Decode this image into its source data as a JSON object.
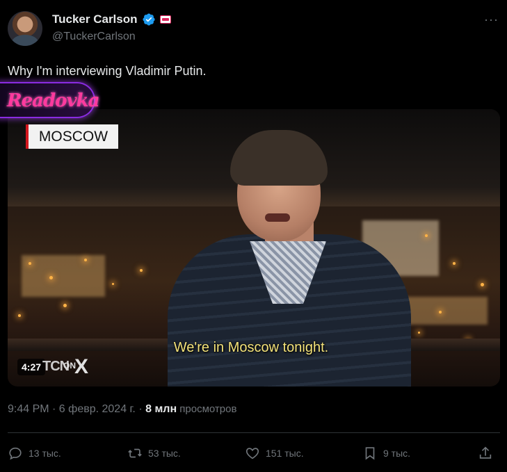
{
  "author": {
    "name": "Tucker Carlson",
    "handle": "@TuckerCarlson",
    "verified_icon": "verified-badge-icon",
    "org_icon": "tcn-org-badge-icon",
    "more_label": "···"
  },
  "tweet": {
    "text": "Why I'm interviewing Vladimir Putin."
  },
  "overlay": {
    "watermark": "Readovka"
  },
  "video": {
    "location_label": "MOSCOW",
    "caption": "We're in Moscow tonight.",
    "duration": "4:27",
    "logo_tcn": "TCN",
    "logo_on": "ON",
    "logo_x": "X"
  },
  "meta": {
    "time": "9:44 PM · 6 февр. 2024 г. · ",
    "views_count": "8 млн",
    "views_label": " просмотров"
  },
  "actions": {
    "replies": "13 тыс.",
    "reposts": "53 тыс.",
    "likes": "151 тыс.",
    "bookmarks": "9 тыс."
  },
  "colors": {
    "background": "#000000",
    "text_primary": "#e7e9ea",
    "text_secondary": "#71767b",
    "verified_blue": "#1d9bf0",
    "caption_yellow": "#f3e27a",
    "divider": "#2f3336"
  }
}
